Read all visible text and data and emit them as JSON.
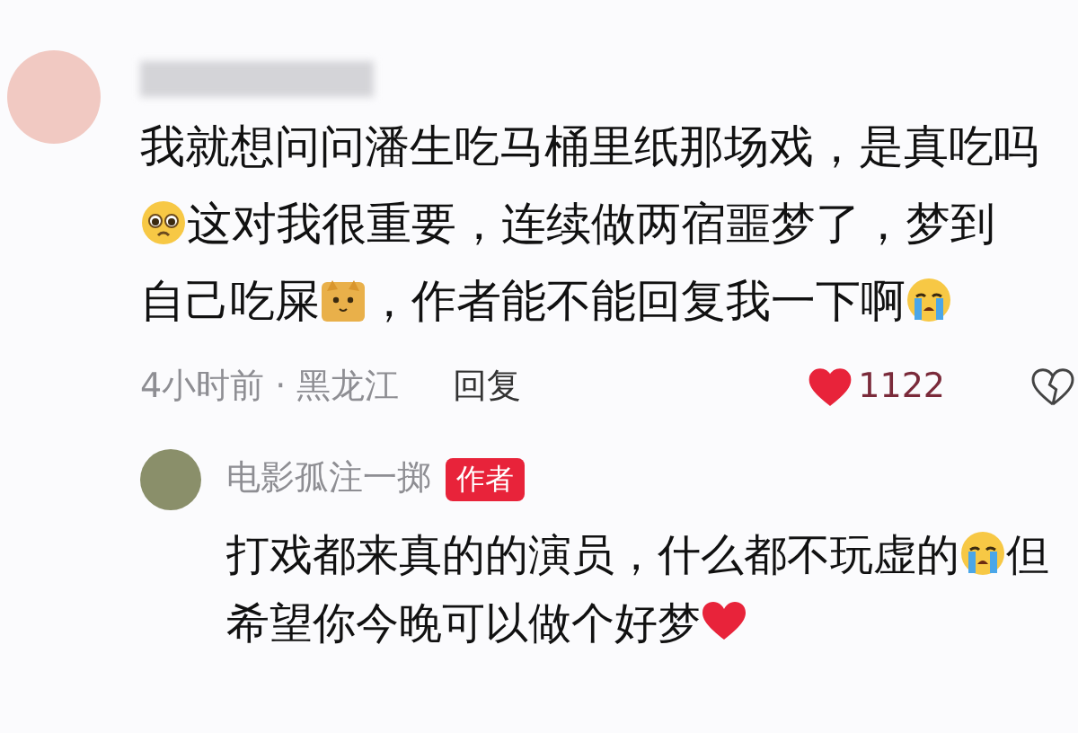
{
  "comment": {
    "body": [
      {
        "kind": "text",
        "text": "我就想问问潘生吃马桶里纸那场戏，是真吃吗"
      },
      {
        "kind": "pleading"
      },
      {
        "kind": "text",
        "text": "这对我很重要，连续做两宿噩梦了，梦到自己吃屎"
      },
      {
        "kind": "cat"
      },
      {
        "kind": "text",
        "text": "，作者能不能回复我一下啊"
      },
      {
        "kind": "crying"
      }
    ],
    "time": "4小时前 · 黑龙江",
    "reply_action": "回复",
    "liked": true,
    "likes": "1122"
  },
  "reply": {
    "author": "电影孤注一掷",
    "badge": "作者",
    "body": [
      {
        "kind": "text",
        "text": "打戏都来真的的演员，什么都不玩虚的"
      },
      {
        "kind": "crying"
      },
      {
        "kind": "text",
        "text": "但希望你今晚可以做个好梦"
      },
      {
        "kind": "heart"
      }
    ]
  }
}
